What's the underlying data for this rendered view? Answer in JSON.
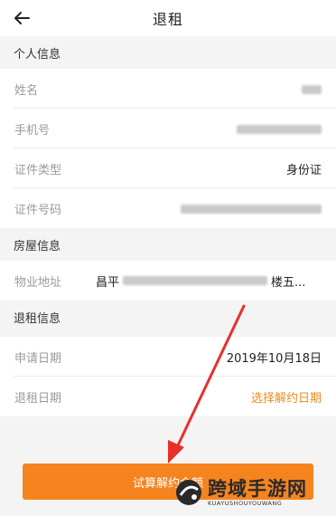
{
  "header": {
    "title": "退租"
  },
  "sections": {
    "personal": {
      "title": "个人信息"
    },
    "house": {
      "title": "房屋信息"
    },
    "rent": {
      "title": "退租信息"
    }
  },
  "personal": {
    "name_label": "姓名",
    "phone_label": "手机号",
    "id_type_label": "证件类型",
    "id_type_value": "身份证",
    "id_number_label": "证件号码"
  },
  "house": {
    "address_label": "物业地址",
    "address_prefix": "昌平",
    "address_suffix": "楼五..."
  },
  "rent": {
    "apply_date_label": "申请日期",
    "apply_date_value": "2019年10月18日",
    "end_date_label": "退租日期",
    "end_date_placeholder": "选择解约日期"
  },
  "action": {
    "calc_button_label": "试算解约金额"
  },
  "watermark": {
    "main": "跨域手游网",
    "sub": "KUAYUSHOUYOUWANG"
  },
  "colors": {
    "accent": "#f5841f",
    "accent_text": "#f08a21",
    "arrow": "#e8302b"
  }
}
